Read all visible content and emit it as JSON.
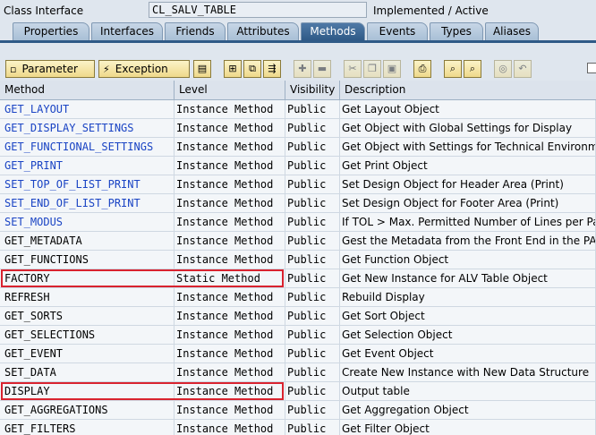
{
  "header": {
    "label": "Class Interface",
    "class_name": "CL_SALV_TABLE",
    "status": "Implemented / Active"
  },
  "tabs": [
    {
      "label": "Properties",
      "active": false
    },
    {
      "label": "Interfaces",
      "active": false
    },
    {
      "label": "Friends",
      "active": false
    },
    {
      "label": "Attributes",
      "active": false
    },
    {
      "label": "Methods",
      "active": true
    },
    {
      "label": "Events",
      "active": false
    },
    {
      "label": "Types",
      "active": false
    },
    {
      "label": "Aliases",
      "active": false
    }
  ],
  "toolbar": {
    "parameter_label": "Parameter",
    "exception_label": "Exception",
    "icons": [
      "source-code-icon",
      "insert-icon",
      "copy-icon",
      "navigate-icon",
      "add-icon",
      "delete-icon",
      "cut-icon",
      "paste-icon",
      "clipboard-icon",
      "print-icon",
      "find-icon",
      "find-next-icon",
      "detail-icon",
      "undo-icon"
    ]
  },
  "table": {
    "columns": [
      "Method",
      "Level",
      "Visibility",
      "Description"
    ],
    "rows": [
      {
        "method": "GET_LAYOUT",
        "level": "Instance Method",
        "visibility": "Public",
        "description": "Get Layout Object",
        "link": true
      },
      {
        "method": "GET_DISPLAY_SETTINGS",
        "level": "Instance Method",
        "visibility": "Public",
        "description": "Get Object with Global Settings for Display",
        "link": true
      },
      {
        "method": "GET_FUNCTIONAL_SETTINGS",
        "level": "Instance Method",
        "visibility": "Public",
        "description": "Get Object with Settings for Technical Environment",
        "link": true
      },
      {
        "method": "GET_PRINT",
        "level": "Instance Method",
        "visibility": "Public",
        "description": "Get Print Object",
        "link": true
      },
      {
        "method": "SET_TOP_OF_LIST_PRINT",
        "level": "Instance Method",
        "visibility": "Public",
        "description": "Set Design Object for Header Area (Print)",
        "link": true
      },
      {
        "method": "SET_END_OF_LIST_PRINT",
        "level": "Instance Method",
        "visibility": "Public",
        "description": "Set Design Object for Footer Area (Print)",
        "link": true
      },
      {
        "method": "SET_MODUS",
        "level": "Instance Method",
        "visibility": "Public",
        "description": "If TOL > Max. Permitted Number of Lines per Page",
        "link": true
      },
      {
        "method": "GET_METADATA",
        "level": "Instance Method",
        "visibility": "Public",
        "description": "Gest the Metadata from the Front End in the PAI",
        "link": false
      },
      {
        "method": "GET_FUNCTIONS",
        "level": "Instance Method",
        "visibility": "Public",
        "description": "Get Function Object",
        "link": false
      },
      {
        "method": "FACTORY",
        "level": "Static Method",
        "visibility": "Public",
        "description": "Get New Instance for ALV Table Object",
        "link": false,
        "highlight": true
      },
      {
        "method": "REFRESH",
        "level": "Instance Method",
        "visibility": "Public",
        "description": "Rebuild Display",
        "link": false
      },
      {
        "method": "GET_SORTS",
        "level": "Instance Method",
        "visibility": "Public",
        "description": "Get Sort Object",
        "link": false
      },
      {
        "method": "GET_SELECTIONS",
        "level": "Instance Method",
        "visibility": "Public",
        "description": "Get Selection Object",
        "link": false
      },
      {
        "method": "GET_EVENT",
        "level": "Instance Method",
        "visibility": "Public",
        "description": "Get Event Object",
        "link": false
      },
      {
        "method": "SET_DATA",
        "level": "Instance Method",
        "visibility": "Public",
        "description": "Create New Instance with New Data Structure",
        "link": false
      },
      {
        "method": "DISPLAY",
        "level": "Instance Method",
        "visibility": "Public",
        "description": "Output table",
        "link": false,
        "highlight": true
      },
      {
        "method": "GET_AGGREGATIONS",
        "level": "Instance Method",
        "visibility": "Public",
        "description": "Get Aggregation Object",
        "link": false
      },
      {
        "method": "GET_FILTERS",
        "level": "Instance Method",
        "visibility": "Public",
        "description": "Get Filter Object",
        "link": false
      }
    ]
  },
  "colors": {
    "link": "#1a44c4",
    "highlight": "#d9232f",
    "active_tab": "#2f5a87"
  }
}
